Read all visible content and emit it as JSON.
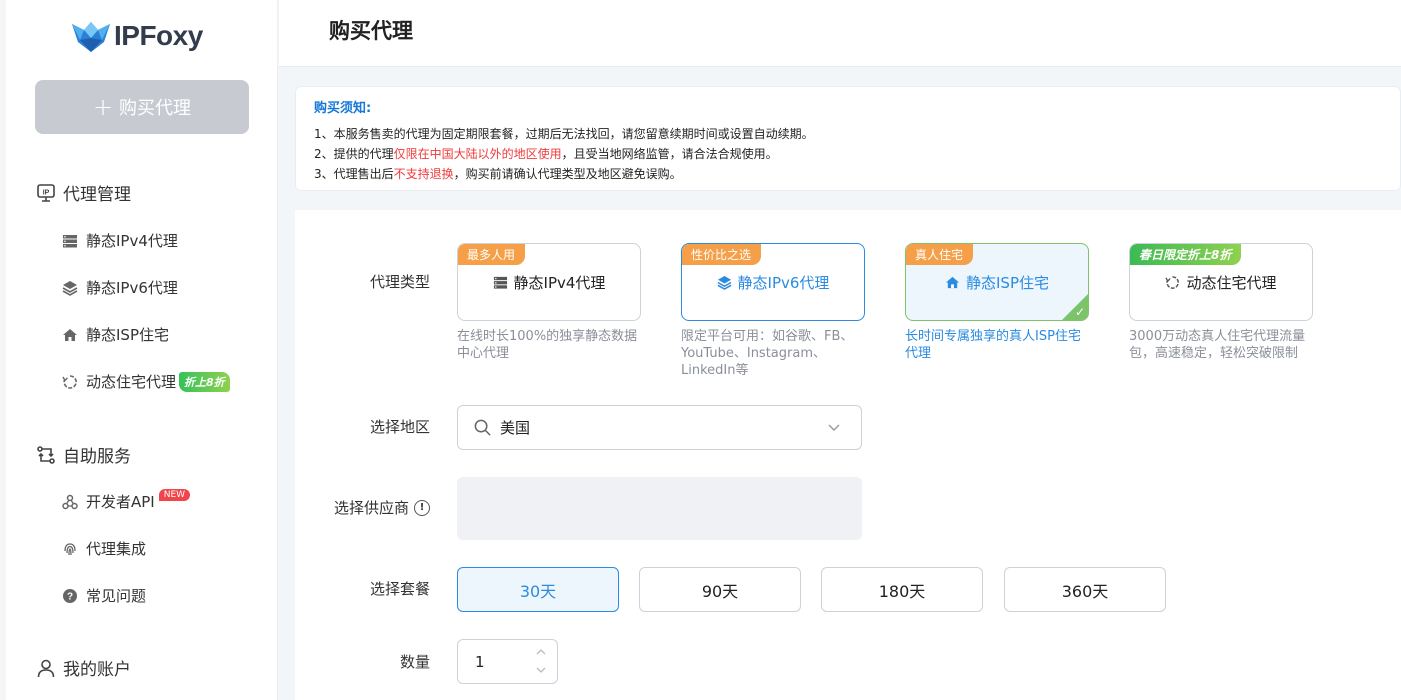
{
  "brand": {
    "name": "IPFoxy"
  },
  "sidebar": {
    "buy_button": "购买代理",
    "groups": [
      {
        "label": "代理管理",
        "icon": "ip-monitor-icon"
      },
      {
        "label": "自助服务",
        "icon": "self-service-icon"
      },
      {
        "label": "我的账户",
        "icon": "user-icon"
      }
    ],
    "items": [
      {
        "label": "静态IPv4代理",
        "icon": "server-icon"
      },
      {
        "label": "静态IPv6代理",
        "icon": "layers-icon"
      },
      {
        "label": "静态ISP住宅",
        "icon": "home-icon"
      },
      {
        "label": "动态住宅代理",
        "icon": "rotate-icon",
        "badge": "折上8折"
      },
      {
        "label": "开发者API",
        "icon": "api-icon",
        "badge": "NEW"
      },
      {
        "label": "代理集成",
        "icon": "fingerprint-icon"
      },
      {
        "label": "常见问题",
        "icon": "help-icon"
      }
    ]
  },
  "header": {
    "title": "购买代理"
  },
  "notice": {
    "title": "购买须知:",
    "line1": "1、本服务售卖的代理为固定期限套餐，过期后无法找回，请您留意续期时间或设置自动续期。",
    "line2_pre": "2、提供的代理",
    "line2_red": "仅限在中国大陆以外的地区使用",
    "line2_post": "，且受当地网络监管，请合法合规使用。",
    "line3_pre": "3、代理售出后",
    "line3_red": "不支持退换",
    "line3_post": "，购买前请确认代理类型及地区避免误购。"
  },
  "form": {
    "type_label": "代理类型",
    "region_label": "选择地区",
    "provider_label": "选择供应商",
    "plan_label": "选择套餐",
    "qty_label": "数量",
    "region_value": "美国",
    "quantity": "1",
    "types": [
      {
        "tag": "最多人用",
        "name": "静态IPv4代理",
        "desc": "在线时长100%的独享静态数据中心代理",
        "tag_color": "#f5a048"
      },
      {
        "tag": "性价比之选",
        "name": "静态IPv6代理",
        "desc": "限定平台可用：如谷歌、FB、YouTube、Instagram、LinkedIn等",
        "tag_color": "#f5a048"
      },
      {
        "tag": "真人住宅",
        "name": "静态ISP住宅",
        "desc": "长时间专属独享的真人ISP住宅代理",
        "tag_color": "#f5a048"
      },
      {
        "tag": "春日限定折上8折",
        "name": "动态住宅代理",
        "desc": "3000万动态真人住宅代理流量包，高速稳定，轻松突破限制",
        "tag_color": "#5cc45a"
      }
    ],
    "plans": [
      "30天",
      "90天",
      "180天",
      "360天"
    ],
    "active_plan": "30天"
  }
}
